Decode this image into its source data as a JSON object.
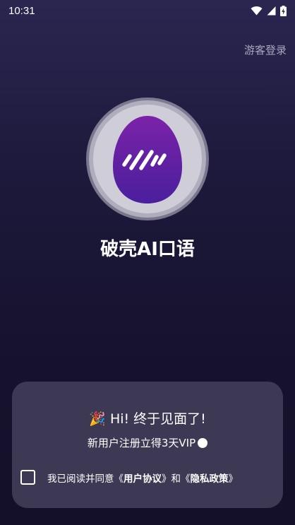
{
  "status_bar": {
    "time": "10:31",
    "icons": [
      "wifi-icon",
      "cell-signal-icon",
      "battery-charging-icon"
    ]
  },
  "header": {
    "guest_login": "游客登录"
  },
  "brand": {
    "app_name": "破壳AI口语",
    "logo_icon": "egg-logo-icon"
  },
  "card": {
    "greeting_emoji": "🎉",
    "greeting": "Hi! 终于见面了!",
    "offer": "新用户注册立得3天VIP",
    "agreement": {
      "prefix": "我已阅读并同意《",
      "user_agreement": "用户协议",
      "middle": "》和《",
      "privacy_policy": "隐私政策",
      "suffix": "》"
    }
  },
  "colors": {
    "background_top": "#2b2650",
    "background_bottom": "#141029",
    "card": "#3d3853",
    "logo_gradient_top": "#7b22a8",
    "logo_gradient_bottom": "#4a1f9e"
  }
}
